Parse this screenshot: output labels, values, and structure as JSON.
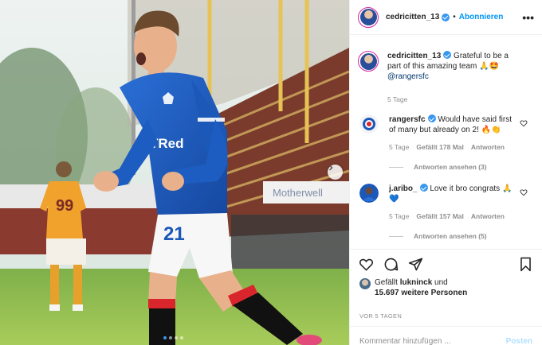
{
  "post": {
    "username": "cedricitten_13",
    "follow_label": "Abonnieren",
    "separator": "•",
    "more_label": "•••",
    "caption": {
      "text": "Grateful to be a part of this amazing team 🙏🤩",
      "mention": "@rangersfc",
      "age": "5 Tage"
    },
    "photo": {
      "sponsor_text": "TRed",
      "number_text": "21",
      "opponent_number": "99",
      "sign_text": "Motherwell",
      "carousel_dots": 4,
      "active_dot": 0
    },
    "colors": {
      "accent": "#0095f6",
      "verified": "#3897f0",
      "rangers_blue": "#1b58b8"
    }
  },
  "comments": [
    {
      "username": "rangersfc",
      "text": "Would have said first of many but already on 2! 🔥👏",
      "age": "5 Tage",
      "likes": "Gefällt 178 Mal",
      "reply_label": "Antworten",
      "view_replies": "Antworten ansehen (3)"
    },
    {
      "username": "j.aribo_",
      "text": "Love it bro congrats 🙏💙",
      "age": "5 Tage",
      "likes": "Gefällt 157 Mal",
      "reply_label": "Antworten",
      "view_replies": "Antworten ansehen (5)"
    }
  ],
  "likes_summary": {
    "prefix": "Gefällt",
    "liker": "lukninck",
    "conjunction": "und",
    "others": "15.697 weitere Personen"
  },
  "timestamp": "VOR 5 TAGEN",
  "add_comment": {
    "placeholder": "Kommentar hinzufügen ...",
    "post_label": "Posten"
  },
  "icons": {
    "like": "heart-icon",
    "comment": "comment-bubble-icon",
    "share": "paper-plane-icon",
    "save": "bookmark-icon",
    "next": "chevron-right-icon"
  }
}
